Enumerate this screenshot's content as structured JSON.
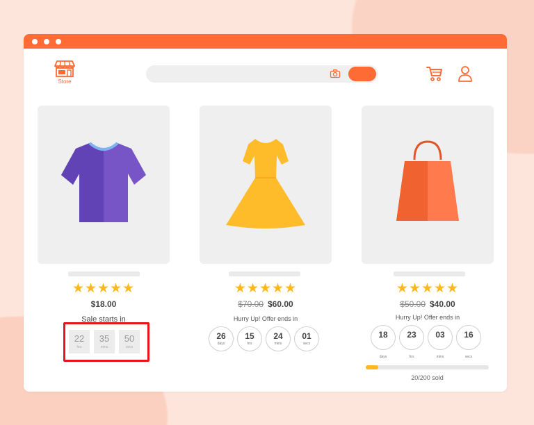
{
  "header": {
    "store_label": "Store",
    "search": {
      "placeholder": ""
    }
  },
  "products": [
    {
      "name": "t-shirt",
      "rating_stars": "★★★★★",
      "price": "$18.00",
      "caption": "Sale starts in",
      "countdown": [
        {
          "value": "22",
          "unit": "hrs"
        },
        {
          "value": "35",
          "unit": "mins"
        },
        {
          "value": "50",
          "unit": "secs"
        }
      ]
    },
    {
      "name": "dress",
      "rating_stars": "★★★★★",
      "old_price": "$70.00",
      "price": "$60.00",
      "caption": "Hurry Up! Offer ends in",
      "countdown": [
        {
          "value": "26",
          "unit": "days"
        },
        {
          "value": "15",
          "unit": "hrs"
        },
        {
          "value": "24",
          "unit": "mins"
        },
        {
          "value": "01",
          "unit": "secs"
        }
      ]
    },
    {
      "name": "shopping-bag",
      "rating_stars": "★★★★★",
      "old_price": "$50.00",
      "price": "$40.00",
      "caption": "Hurry Up! Offer ends in",
      "countdown": [
        {
          "value": "18",
          "unit": "days"
        },
        {
          "value": "23",
          "unit": "hrs"
        },
        {
          "value": "03",
          "unit": "mins"
        },
        {
          "value": "16",
          "unit": "secs"
        }
      ],
      "sold_progress": 0.1,
      "sold_label": "20/200 sold"
    }
  ],
  "colors": {
    "accent": "#ff6b35",
    "star": "#ffb81c",
    "highlight": "#e8141a",
    "shirt": "#6b4fbb",
    "dress": "#ffbc2a",
    "bag": "#ff6b3d"
  },
  "icons": {
    "logo": "store-icon",
    "search": "camera-icon",
    "cart": "cart-icon",
    "user": "user-icon"
  }
}
